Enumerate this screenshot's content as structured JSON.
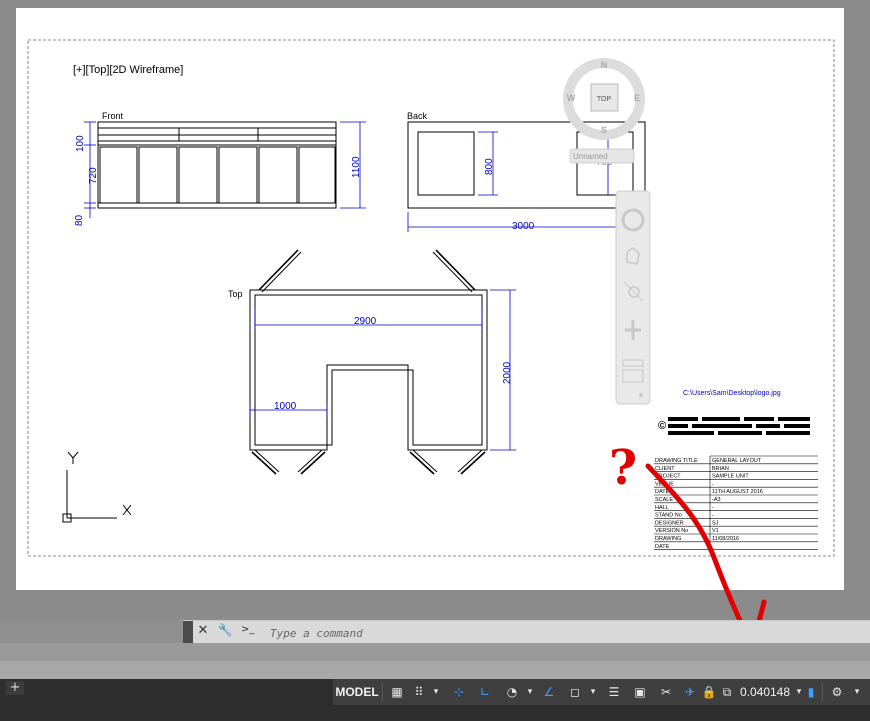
{
  "viewport": {
    "label": "[+][Top][2D Wireframe]"
  },
  "drawing": {
    "front_label": "Front",
    "back_label": "Back",
    "top_label": "Top",
    "dims": {
      "front_100": "100",
      "front_720": "720",
      "front_80": "80",
      "front_1100": "1100",
      "back_800": "800",
      "back_700": "700",
      "back_3000": "3000",
      "top_2900": "2900",
      "top_2000": "2000",
      "top_1000": "1000"
    },
    "logo_path": "C:\\Users\\Sam\\Desktop\\logo.jpg",
    "title_block": {
      "rows": [
        {
          "label": "DRAWING TITLE",
          "value": "GENERAL LAYOUT"
        },
        {
          "label": "CLIENT",
          "value": "BRIAN"
        },
        {
          "label": "PROJECT",
          "value": "SAMPLE UNIT"
        },
        {
          "label": "VENUE",
          "value": "-"
        },
        {
          "label": "DATES",
          "value": "11TH AUGUST 2016"
        },
        {
          "label": "SCALE",
          "value": "-A3"
        },
        {
          "label": "HALL",
          "value": "-"
        },
        {
          "label": "STAND No",
          "value": "-"
        },
        {
          "label": "DESIGNER",
          "value": "SJ"
        },
        {
          "label": "VERSION No",
          "value": "V1"
        },
        {
          "label": "DRAWING",
          "value": "11/08/2016"
        },
        {
          "label": "DATE",
          "value": ""
        }
      ]
    }
  },
  "viewcube": {
    "north": "N",
    "south": "S",
    "east": "E",
    "west": "W",
    "face": "TOP",
    "ucs": "Unnamed"
  },
  "ucs_icon": {
    "x_label": "X",
    "y_label": "Y"
  },
  "annotation": {
    "mark": "?"
  },
  "command_line": {
    "placeholder": "Type a command",
    "close": "✕",
    "tool": "🔧",
    "prompt_icon": ">_"
  },
  "layout_tabs": {
    "add": "+"
  },
  "status_bar": {
    "model": "MODEL",
    "annotation_scale": "0.040148",
    "dropdown": "▾",
    "gear": "⚙"
  },
  "colors": {
    "dimension": "#0000c8",
    "annotation": "#e00000",
    "status_bg": "#2e2e2e"
  }
}
